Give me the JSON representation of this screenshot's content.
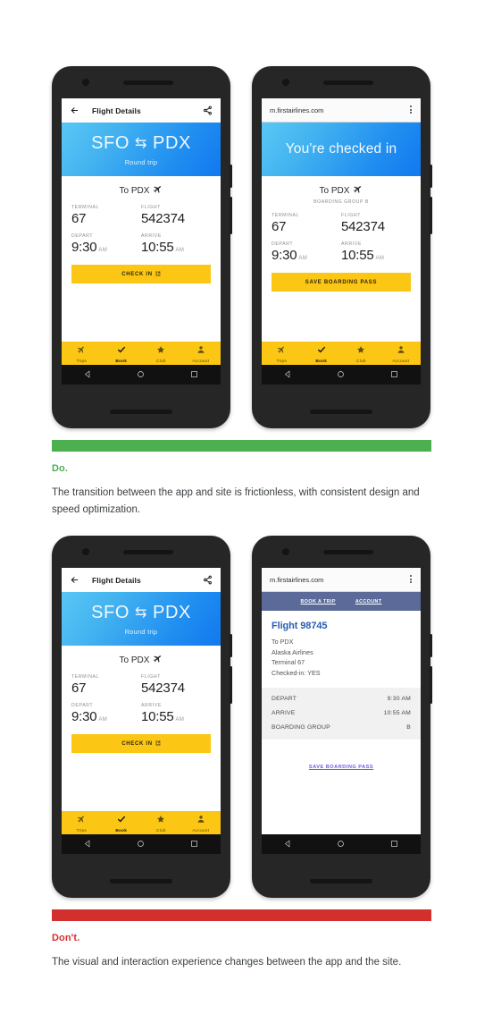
{
  "app_screen": {
    "header": {
      "title": "Flight Details",
      "back_icon": "arrow-left-icon",
      "share_icon": "share-icon"
    },
    "hero": {
      "origin": "SFO",
      "swap": "⇆",
      "destination": "PDX",
      "subtitle": "Round trip"
    },
    "destination_line": "To PDX",
    "fields": [
      {
        "label": "TERMINAL",
        "value": "67"
      },
      {
        "label": "FLIGHT",
        "value": "542374"
      },
      {
        "label": "DEPART",
        "value": "9:30",
        "suffix": "AM"
      },
      {
        "label": "ARRIVE",
        "value": "10:55",
        "suffix": "AM"
      }
    ],
    "cta": "CHECK IN",
    "tabs": [
      {
        "label": "Trips",
        "icon": "airplane-icon",
        "active": false
      },
      {
        "label": "Book",
        "icon": "check-icon",
        "active": true
      },
      {
        "label": "Club",
        "icon": "star-icon",
        "active": false
      },
      {
        "label": "Account",
        "icon": "person-icon",
        "active": false
      }
    ]
  },
  "web_good_screen": {
    "browser": {
      "url": "m.firstairlines.com",
      "menu_icon": "kebab-menu-icon"
    },
    "hero": {
      "title": "You're checked in"
    },
    "destination_line": "To PDX",
    "boarding_group": "BOARDING GROUP B",
    "fields": [
      {
        "label": "TERMINAL",
        "value": "67"
      },
      {
        "label": "FLIGHT",
        "value": "542374"
      },
      {
        "label": "DEPART",
        "value": "9:30",
        "suffix": "AM"
      },
      {
        "label": "ARRIVE",
        "value": "10:55",
        "suffix": "AM"
      }
    ],
    "cta": "SAVE BOARDING PASS",
    "tabs": [
      {
        "label": "Trips",
        "icon": "airplane-icon",
        "active": false
      },
      {
        "label": "Book",
        "icon": "check-icon",
        "active": true
      },
      {
        "label": "Club",
        "icon": "star-icon",
        "active": false
      },
      {
        "label": "Account",
        "icon": "person-icon",
        "active": false
      }
    ]
  },
  "web_bad_screen": {
    "browser": {
      "url": "m.firstairlines.com",
      "menu_icon": "kebab-menu-icon"
    },
    "nav": [
      "BOOK A TRIP",
      "ACCOUNT"
    ],
    "title": "Flight 98745",
    "details": [
      "To PDX",
      "Alaska Airlines",
      "Terminal 67",
      "Checked-in: YES"
    ],
    "table": [
      {
        "label": "DEPART",
        "value": "9:30 AM"
      },
      {
        "label": "ARRIVE",
        "value": "10:55 AM"
      },
      {
        "label": "BOARDING GROUP",
        "value": "B"
      }
    ],
    "link": "SAVE BOARDING PASS"
  },
  "annotations": {
    "do": {
      "kicker": "Do.",
      "description": "The transition between the app and site is frictionless, with consistent design and speed optimization."
    },
    "dont": {
      "kicker": "Don't.",
      "description": "The visual and interaction experience changes between the app and the site."
    }
  },
  "colors": {
    "do_rule": "#4caf50",
    "dont_rule": "#d32f2f",
    "brand_yellow": "#fcc614",
    "hero_blue_light": "#59c7f5",
    "hero_blue_dark": "#1278ef",
    "legacy_nav": "#5c6a99",
    "legacy_title": "#2a5db0",
    "legacy_link": "#6b5ce7"
  }
}
